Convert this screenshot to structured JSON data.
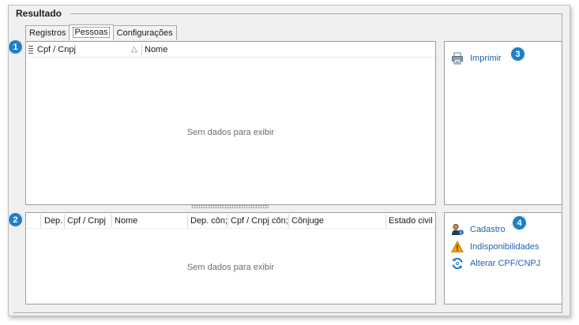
{
  "group": {
    "title": "Resultado"
  },
  "tabs": [
    {
      "label": "Registros",
      "active": false
    },
    {
      "label": "Pessoas",
      "active": true
    },
    {
      "label": "Configurações",
      "active": false
    }
  ],
  "badges": [
    "1",
    "2",
    "3",
    "4"
  ],
  "grid_top": {
    "columns": [
      "Cpf / Cnpj",
      "Nome"
    ],
    "sort_indicator": "△",
    "empty_text": "Sem dados para exibir"
  },
  "grid_bottom": {
    "columns": [
      "Dep.",
      "Cpf / Cnpj",
      "Nome",
      "Dep. côn;",
      "Cpf / Cnpj côn;",
      "Cônjuge",
      "Estado civil"
    ],
    "empty_text": "Sem dados para exibir"
  },
  "actions_top": {
    "print": {
      "label": "Imprimir",
      "icon": "printer-icon"
    }
  },
  "actions_bottom": {
    "items": [
      {
        "label": "Cadastro",
        "icon": "user-info-icon"
      },
      {
        "label": "Indisponibilidades",
        "icon": "warning-icon"
      },
      {
        "label": "Alterar CPF/CNPJ",
        "icon": "refresh-icon"
      }
    ]
  },
  "colors": {
    "badge": "#1e7fc6",
    "link": "#1f63b0",
    "warning": "#f0a30a"
  }
}
